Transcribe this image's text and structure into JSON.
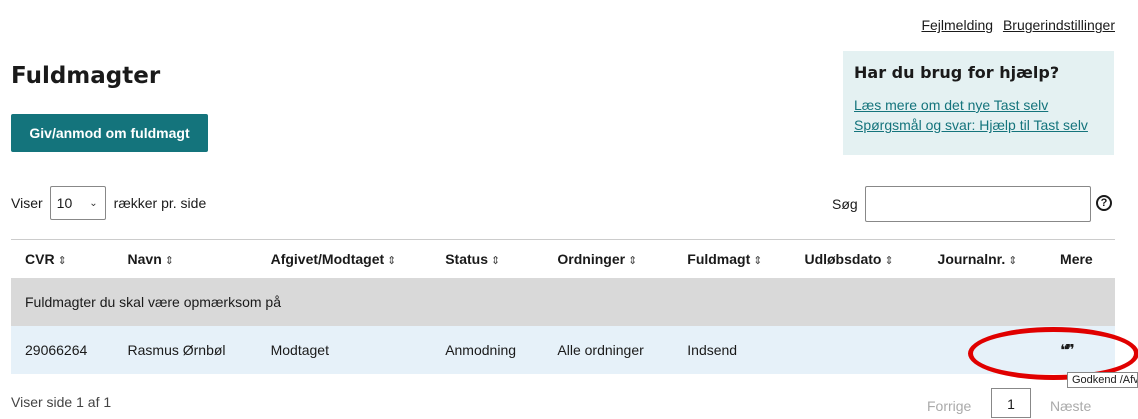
{
  "toplinks": {
    "report": "Fejlmelding",
    "settings": "Brugerindstillinger"
  },
  "page": {
    "title": "Fuldmagter",
    "primary_button": "Giv/anmod om fuldmagt"
  },
  "help": {
    "title": "Har du brug for hjælp?",
    "link1": "Læs mere om det nye Tast selv",
    "link2": "Spørgsmål og svar: Hjælp til Tast selv"
  },
  "controls": {
    "show_label": "Viser",
    "page_size": "10",
    "rows_label": "rækker pr. side",
    "search_label": "Søg",
    "search_value": "",
    "help_icon": "?"
  },
  "table": {
    "columns": [
      "CVR",
      "Navn",
      "Afgivet/Modtaget",
      "Status",
      "Ordninger",
      "Fuldmagt",
      "Udløbsdato",
      "Journalnr.",
      "Mere"
    ],
    "sort_icon": "⇕",
    "group_label": "Fuldmagter du skal være opmærksom på",
    "rows": [
      [
        "29066264",
        "Rasmus Ørnbøl",
        "Modtaget",
        "Anmodning",
        "Alle ordninger",
        "Indsend",
        "",
        "",
        ""
      ]
    ]
  },
  "tooltip": "Godkend /Afvis",
  "footer": {
    "page_info": "Viser side 1 af 1",
    "prev": "Forrige",
    "page": "1",
    "next": "Næste"
  }
}
